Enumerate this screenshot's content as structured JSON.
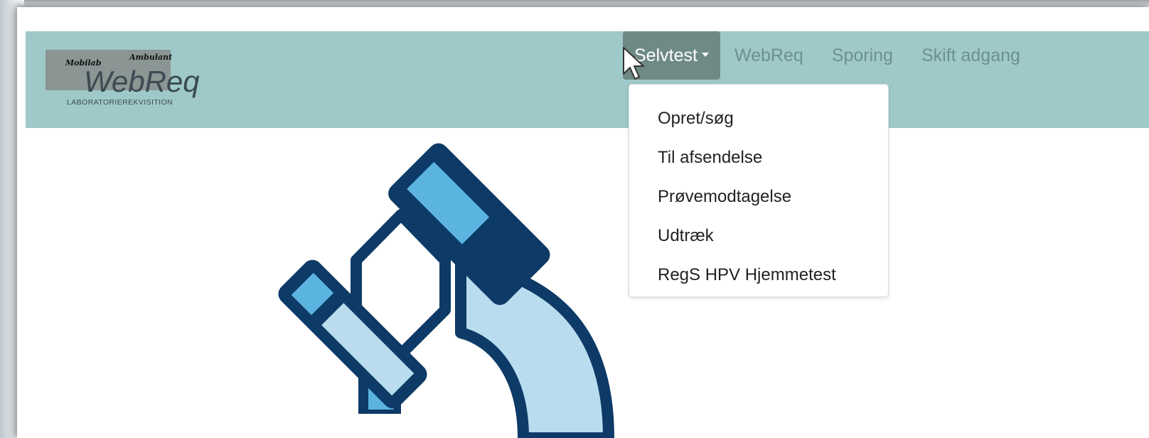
{
  "logo": {
    "top_left": "Mobilab",
    "top_right": "Ambulant",
    "main": "WebReq",
    "subtitle": "LABORATORIEREKVISITION"
  },
  "nav": {
    "items": [
      {
        "label": "Selvtest",
        "active": true,
        "dropdown": true
      },
      {
        "label": "WebReq"
      },
      {
        "label": "Sporing"
      },
      {
        "label": "Skift adgang"
      }
    ]
  },
  "dropdown": {
    "items": [
      {
        "label": "Opret/søg"
      },
      {
        "label": "Til afsendelse"
      },
      {
        "label": "Prøvemodtagelse"
      },
      {
        "label": "Udtræk"
      },
      {
        "label": "RegS HPV Hjemmetest"
      }
    ]
  },
  "colors": {
    "navbar_bg": "#9fc9c9",
    "active_nav_bg": "#6f8a86",
    "microscope_outline": "#0d3a66",
    "microscope_fill_light": "#b9dcef",
    "microscope_fill_accent": "#5bb3e0"
  },
  "icons": {
    "illustration": "microscope-icon",
    "pointer": "mouse-cursor-icon",
    "dropdown_toggle": "caret-down-icon"
  }
}
